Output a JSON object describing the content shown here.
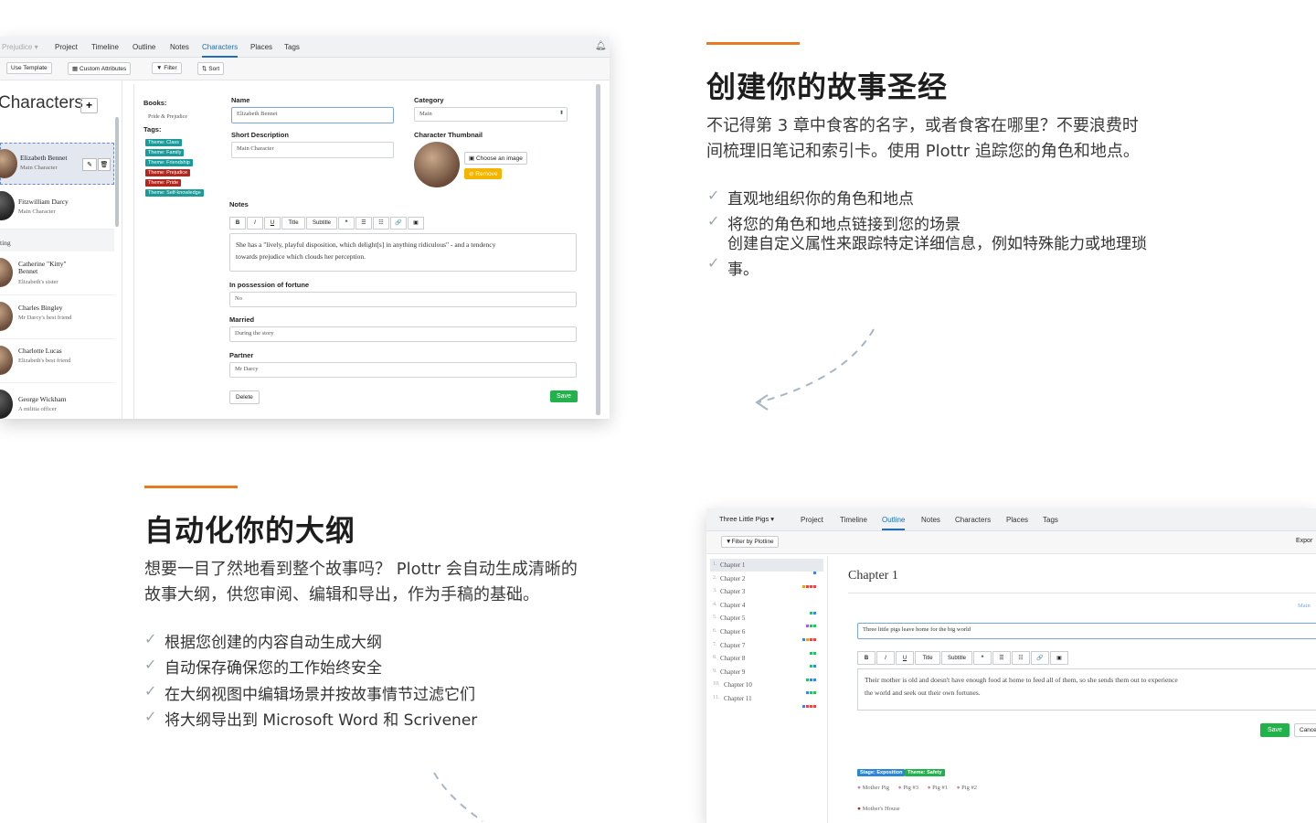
{
  "section1": {
    "title": "创建你的故事圣经",
    "paragraph_line1": "不记得第 3 章中食客的名字，或者食客在哪里？不要浪费时",
    "paragraph_line2": "间梳理旧笔记和索引卡。使用 Plottr 追踪您的角色和地点。",
    "features": [
      "直观地组织你的角色和地点",
      "将您的角色和地点链接到您的场景"
    ],
    "feature3_line1": "创建自定义属性来跟踪特定详细信息，例如特殊能力或地理琐",
    "feature3_line2": "事。"
  },
  "section2": {
    "title": "自动化你的大纲",
    "paragraph_line1": "想要一目了然地看到整个故事吗？ Plottr 会自动生成清晰的",
    "paragraph_line2": "故事大纲，供您审阅、编辑和导出，作为手稿的基础。",
    "features": [
      "根据您创建的内容自动生成大纲",
      "自动保存确保您的工作始终安全",
      "在大纲视图中编辑场景并按故事情节过滤它们",
      "将大纲导出到 Microsoft Word 和 Scrivener"
    ]
  },
  "app1": {
    "book_dropdown": "Prejudice ▾",
    "tabs": [
      "Project",
      "Timeline",
      "Outline",
      "Notes",
      "Characters",
      "Places",
      "Tags"
    ],
    "active_tab": "Characters",
    "toolbar": [
      "Use Template",
      "Custom Attributes",
      "Filter",
      "Sort"
    ],
    "heading": "Characters",
    "add_label": "+",
    "group_label": "ting",
    "characters": [
      {
        "name": "Elizabeth Bennet",
        "desc": "Main Character"
      },
      {
        "name": "Fitzwilliam Darcy",
        "desc": "Main Character"
      },
      {
        "name": "Catherine \"Kitty\" Bennet",
        "desc": "Elizabeth's sister"
      },
      {
        "name": "Charles Bingley",
        "desc": "Mr Darcy's best friend"
      },
      {
        "name": "Charlotte Lucas",
        "desc": "Elizabeth's best friend"
      },
      {
        "name": "George Wickham",
        "desc": "A militia officer"
      }
    ],
    "books_label": "Books:",
    "book_name": "Pride & Prejudice",
    "tags_label": "Tags:",
    "tags": [
      {
        "text": "Theme: Class",
        "color": "#1b9a9a"
      },
      {
        "text": "Theme: Family",
        "color": "#1b9a9a"
      },
      {
        "text": "Theme: Friendship",
        "color": "#1b9a9a"
      },
      {
        "text": "Theme: Prejudice",
        "color": "#b3261e"
      },
      {
        "text": "Theme: Pride",
        "color": "#b3261e"
      },
      {
        "text": "Theme: Self-knowledge",
        "color": "#1b9a9a"
      }
    ],
    "name_label": "Name",
    "name_value": "Elizabeth Bennet",
    "short_desc_label": "Short Description",
    "short_desc_value": "Main Character",
    "category_label": "Category",
    "category_value": "Main",
    "thumbnail_label": "Character Thumbnail",
    "choose_image": "Choose an image",
    "remove": "Remove",
    "notes_label": "Notes",
    "editor_buttons": [
      "B",
      "I",
      "U",
      "Title",
      "Subtitle",
      "❝",
      "☰",
      "☷",
      "🔗",
      "▣"
    ],
    "notes_line1": "She has a \"lively, playful disposition, which delight[s] in anything ridiculous\" - and a tendency",
    "notes_line2": "towards prejudice which clouds her perception.",
    "fortune_label": "In possession of fortune",
    "fortune_value": "No",
    "married_label": "Married",
    "married_value": "During the story",
    "partner_label": "Partner",
    "partner_value": "Mr Darcy",
    "delete": "Delete",
    "save": "Save"
  },
  "app2": {
    "book_dropdown": "Three Little Pigs ▾",
    "tabs": [
      "Project",
      "Timeline",
      "Outline",
      "Notes",
      "Characters",
      "Places",
      "Tags"
    ],
    "active_tab": "Outline",
    "filter": "Filter by Plotline",
    "export": "Expor",
    "chapters": [
      "Chapter 1",
      "Chapter 2",
      "Chapter 3",
      "Chapter 4",
      "Chapter 5",
      "Chapter 6",
      "Chapter 7",
      "Chapter 8",
      "Chapter 9",
      "Chapter 10",
      "Chapter 11"
    ],
    "chapter_title": "Chapter 1",
    "main_label": "Main",
    "scene_title": "Three little pigs leave home for the big world",
    "editor_buttons": [
      "B",
      "I",
      "U",
      "Title",
      "Subtitle",
      "❝",
      "☰",
      "☷",
      "🔗",
      "▣"
    ],
    "scene_line1": "Their mother is old and doesn't have enough food at home to feed all of them, so she sends them out to experience",
    "scene_line2": "the world and seek out their own fortunes.",
    "save": "Save",
    "cancel": "Cance",
    "tags": [
      "Stage: Exposition",
      "Theme: Safety"
    ],
    "characters": [
      "Mother Pig",
      "Pig #3",
      "Pig #1",
      "Pig #2"
    ],
    "place": "Mother's House"
  },
  "colors": {
    "accent": "#e87a24",
    "save_green": "#22b24c",
    "link_blue": "#1e6fb8",
    "check_gray": "#9aa5ad"
  }
}
